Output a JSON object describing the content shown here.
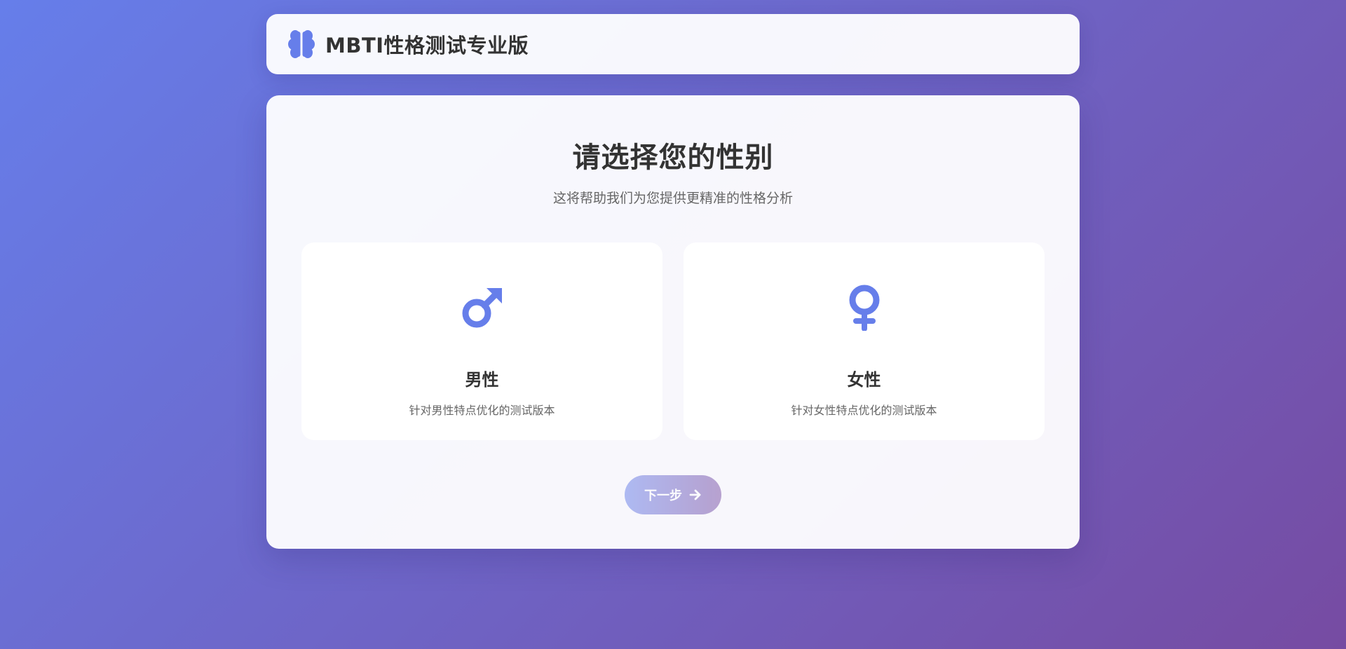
{
  "header": {
    "app_title": "MBTI性格测试专业版",
    "icon": "brain-icon"
  },
  "main": {
    "title": "请选择您的性别",
    "subtitle": "这将帮助我们为您提供更精准的性格分析",
    "options": [
      {
        "label": "男性",
        "description": "针对男性特点优化的测试版本",
        "icon": "male-icon"
      },
      {
        "label": "女性",
        "description": "针对女性特点优化的测试版本",
        "icon": "female-icon"
      }
    ],
    "next_button": {
      "label": "下一步",
      "icon": "arrow-right-icon",
      "enabled": false
    }
  },
  "colors": {
    "accent": "#667eea",
    "gradient_start": "#667eea",
    "gradient_end": "#764ba2",
    "heading_text": "#333333",
    "muted_text": "#666666"
  }
}
